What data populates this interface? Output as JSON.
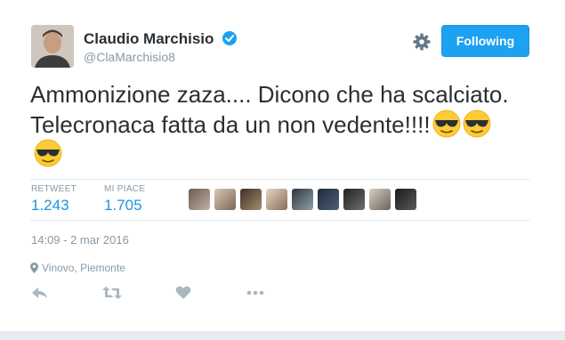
{
  "author": {
    "name": "Claudio Marchisio",
    "handle": "@ClaMarchisio8",
    "verified_icon": "verified-badge-icon"
  },
  "header": {
    "follow_label": "Following",
    "settings_icon": "gear-icon"
  },
  "tweet": {
    "line1": "Ammonizione zaza.... Dicono che ha scalciato.",
    "line2": "Telecronaca fatta da un non vedente!!!!",
    "emoji": "smiling-face-with-sunglasses"
  },
  "stats": {
    "retweet_label": "RETWEET",
    "retweet_count": "1.243",
    "likes_label": "MI PIACE",
    "likes_count": "1.705"
  },
  "likers_count_shown": 9,
  "timestamp": "14:09 - 2 mar 2016",
  "location": "Vinovo, Piemonte",
  "actions": [
    "reply-icon",
    "retweet-icon",
    "heart-icon",
    "more-icon"
  ],
  "colors": {
    "accent": "#1da1f2",
    "link": "#1b95e0",
    "muted": "#8899a6",
    "text": "#292f33"
  }
}
